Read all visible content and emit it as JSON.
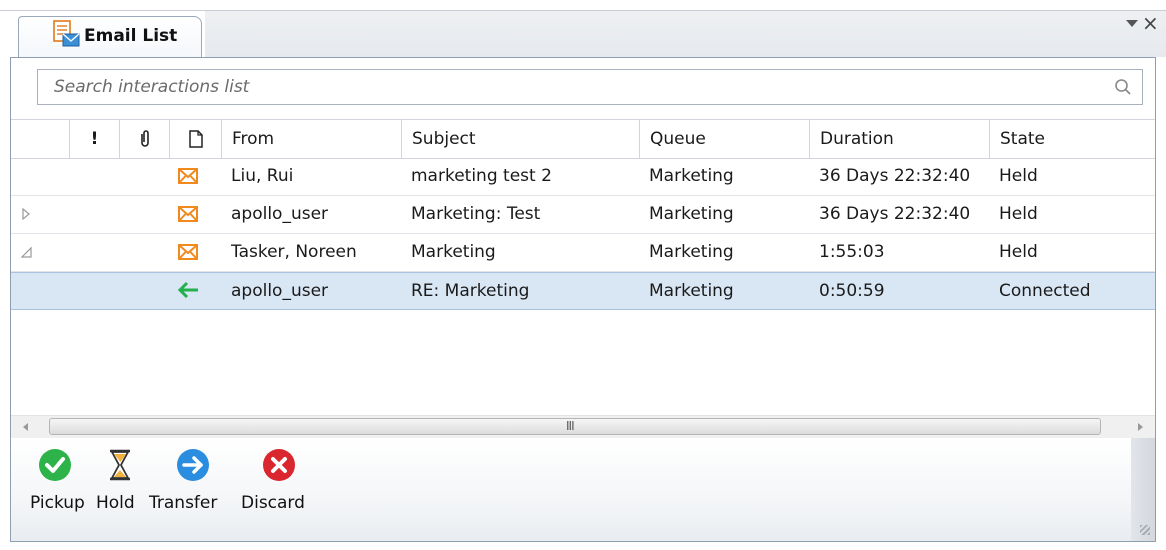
{
  "tab": {
    "title": "Email List",
    "icon": "email-list-icon"
  },
  "window_controls": {
    "menu_icon": "dropdown-arrow-icon",
    "close_symbol": "×"
  },
  "search": {
    "placeholder": "Search interactions list",
    "value": "",
    "icon": "search-icon"
  },
  "columns": {
    "priority": "!",
    "attachment_icon": "paperclip-icon",
    "type_icon": "document-icon",
    "from": "From",
    "subject": "Subject",
    "queue": "Queue",
    "duration": "Duration",
    "state": "State"
  },
  "rows": [
    {
      "expander": "",
      "icon": "envelope-icon",
      "from": "Liu, Rui",
      "subject": "marketing test 2",
      "queue": "Marketing",
      "duration": "36 Days 22:32:40",
      "state": "Held",
      "selected": false
    },
    {
      "expander": "collapsed",
      "icon": "envelope-icon",
      "from": "apollo_user",
      "subject": "Marketing: Test",
      "queue": "Marketing",
      "duration": "36 Days 22:32:40",
      "state": "Held",
      "selected": false
    },
    {
      "expander": "expanded",
      "icon": "envelope-icon",
      "from": "Tasker, Noreen",
      "subject": "Marketing",
      "queue": "Marketing",
      "duration": "1:55:03",
      "state": "Held",
      "selected": false
    },
    {
      "expander": "",
      "icon": "reply-arrow-icon",
      "from": "apollo_user",
      "subject": "RE: Marketing",
      "queue": "Marketing",
      "duration": "0:50:59",
      "state": "Connected",
      "selected": true
    }
  ],
  "scrollbar": {
    "grip": "III"
  },
  "toolbar": {
    "pickup_label": "Pickup",
    "hold_label": "Hold",
    "transfer_label": "Transfer",
    "discard_label": "Discard"
  },
  "colors": {
    "pickup": "#2db34a",
    "hold": "#e8a33a",
    "transfer": "#2a8de0",
    "discard": "#d9262f",
    "envelope": "#f08a1e",
    "reply_arrow": "#22b14c",
    "selected_row": "#d9e6f4"
  }
}
